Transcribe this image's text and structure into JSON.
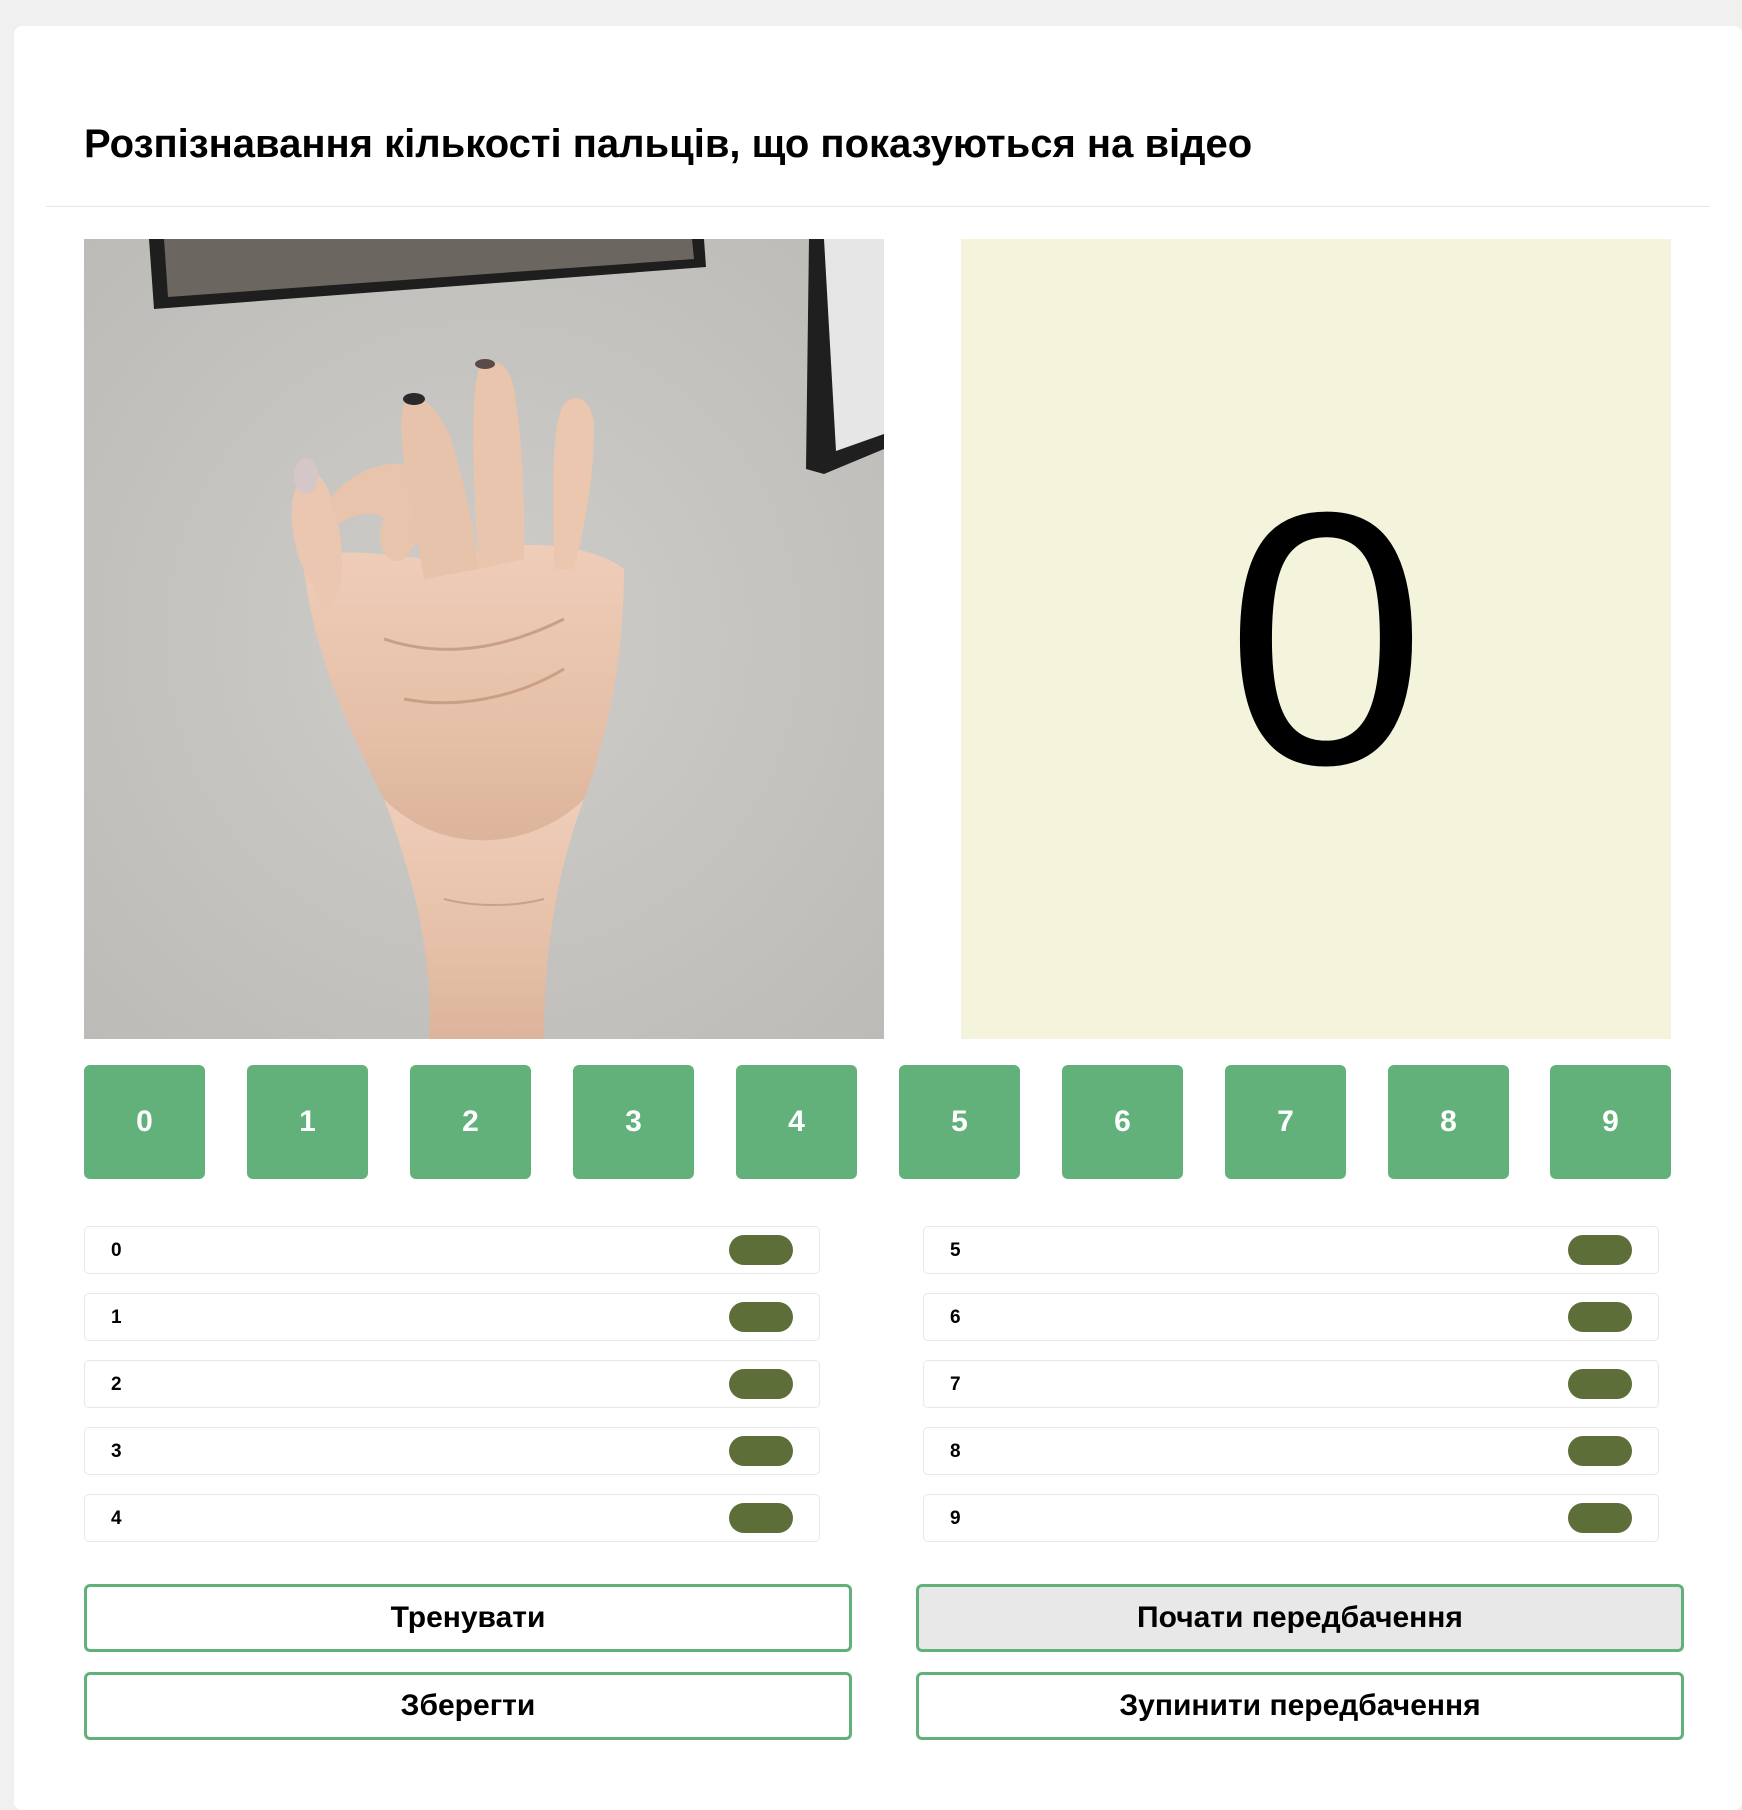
{
  "page": {
    "title": "Розпізнавання кількості пальців, що показуються на відео"
  },
  "prediction": {
    "value": "0"
  },
  "class_buttons": [
    "0",
    "1",
    "2",
    "3",
    "4",
    "5",
    "6",
    "7",
    "8",
    "9"
  ],
  "counts_left": [
    {
      "label": "0"
    },
    {
      "label": "1"
    },
    {
      "label": "2"
    },
    {
      "label": "3"
    },
    {
      "label": "4"
    }
  ],
  "counts_right": [
    {
      "label": "5"
    },
    {
      "label": "6"
    },
    {
      "label": "7"
    },
    {
      "label": "8"
    },
    {
      "label": "9"
    }
  ],
  "actions": {
    "train": "Тренувати",
    "save": "Зберегти",
    "start_predict": "Почати передбачення",
    "stop_predict": "Зупинити передбачення"
  },
  "colors": {
    "class_button": "#62b17a",
    "count_pill": "#5e6e38",
    "prediction_bg": "#f4f4dd",
    "action_border": "#62b17a"
  }
}
